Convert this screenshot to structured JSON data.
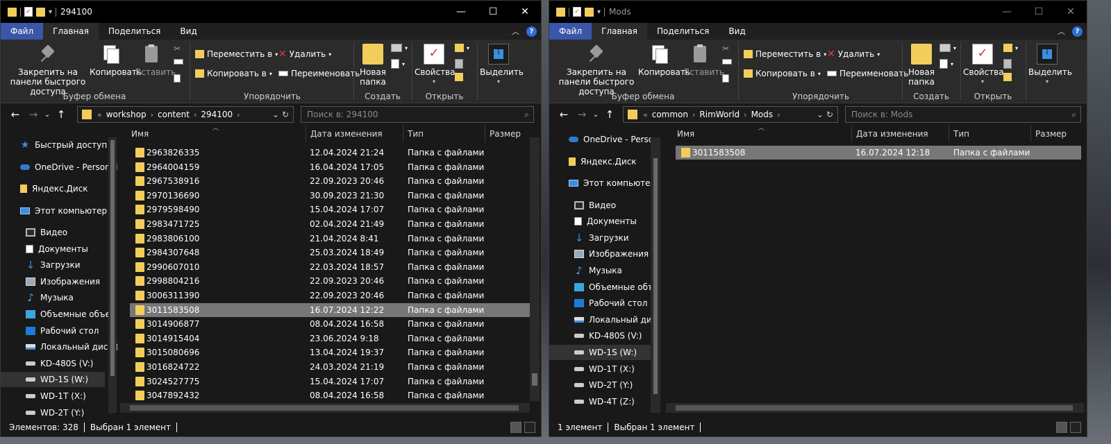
{
  "common": {
    "tabs": [
      "Файл",
      "Главная",
      "Поделиться",
      "Вид"
    ],
    "ribbon": {
      "pin_label": "Закрепить на панели быстрого доступа",
      "copy_label": "Копировать",
      "paste_label": "Вставить",
      "clipboard_group": "Буфер обмена",
      "move_to": "Переместить в",
      "copy_to": "Копировать в",
      "delete": "Удалить",
      "rename": "Переименовать",
      "organize_group": "Упорядочить",
      "new_folder": "Новая папка",
      "create_group": "Создать",
      "properties": "Свойства",
      "open_group": "Открыть",
      "select": "Выделить"
    },
    "column_headers": [
      "Имя",
      "Дата изменения",
      "Тип",
      "Размер"
    ],
    "caption": {
      "minimize": "—",
      "maximize": "☐",
      "close": "✕"
    },
    "help": "?"
  },
  "left_window": {
    "title": "294100",
    "path": [
      "workshop",
      "content",
      "294100"
    ],
    "search_placeholder": "Поиск в: 294100",
    "nav_items": [
      {
        "label": "Быстрый доступ",
        "icon": "star-icon"
      },
      {
        "label": "OneDrive - Personal",
        "icon": "cloud-icon"
      },
      {
        "label": "Яндекс.Диск",
        "icon": "yandex-disk-icon"
      },
      {
        "label": "Этот компьютер",
        "icon": "computer-icon"
      },
      {
        "label": "Видео",
        "icon": "video-icon"
      },
      {
        "label": "Документы",
        "icon": "documents-icon"
      },
      {
        "label": "Загрузки",
        "icon": "downloads-icon"
      },
      {
        "label": "Изображения",
        "icon": "images-icon"
      },
      {
        "label": "Музыка",
        "icon": "music-icon"
      },
      {
        "label": "Объемные объек",
        "icon": "3d-objects-icon"
      },
      {
        "label": "Рабочий стол",
        "icon": "desktop-icon"
      },
      {
        "label": "Локальный диск (",
        "icon": "local-disk-icon"
      },
      {
        "label": "KD-480S (V:)",
        "icon": "drive-icon"
      },
      {
        "label": "WD-1S (W:)",
        "icon": "drive-icon",
        "selected": true
      },
      {
        "label": "WD-1T (X:)",
        "icon": "drive-icon"
      },
      {
        "label": "WD-2T (Y:)",
        "icon": "drive-icon"
      }
    ],
    "files": [
      {
        "name": "2963826335",
        "date": "12.04.2024 21:24",
        "type": "Папка с файлами"
      },
      {
        "name": "2964004159",
        "date": "16.04.2024 17:05",
        "type": "Папка с файлами"
      },
      {
        "name": "2967538916",
        "date": "22.09.2023 20:46",
        "type": "Папка с файлами"
      },
      {
        "name": "2970136690",
        "date": "30.09.2023 21:30",
        "type": "Папка с файлами"
      },
      {
        "name": "2979598490",
        "date": "15.04.2024 17:07",
        "type": "Папка с файлами"
      },
      {
        "name": "2983471725",
        "date": "02.04.2024 21:49",
        "type": "Папка с файлами"
      },
      {
        "name": "2983806100",
        "date": "21.04.2024 8:41",
        "type": "Папка с файлами"
      },
      {
        "name": "2984307648",
        "date": "25.03.2024 18:49",
        "type": "Папка с файлами"
      },
      {
        "name": "2990607010",
        "date": "22.03.2024 18:57",
        "type": "Папка с файлами"
      },
      {
        "name": "2998804216",
        "date": "22.09.2023 20:46",
        "type": "Папка с файлами"
      },
      {
        "name": "3006311390",
        "date": "22.09.2023 20:46",
        "type": "Папка с файлами"
      },
      {
        "name": "3011583508",
        "date": "16.07.2024 12:22",
        "type": "Папка с файлами",
        "selected": true
      },
      {
        "name": "3014906877",
        "date": "08.04.2024 16:58",
        "type": "Папка с файлами"
      },
      {
        "name": "3014915404",
        "date": "23.06.2024 9:18",
        "type": "Папка с файлами"
      },
      {
        "name": "3015080696",
        "date": "13.04.2024 19:37",
        "type": "Папка с файлами"
      },
      {
        "name": "3016824722",
        "date": "24.03.2024 21:19",
        "type": "Папка с файлами"
      },
      {
        "name": "3024527775",
        "date": "15.04.2024 17:07",
        "type": "Папка с файлами"
      },
      {
        "name": "3047892432",
        "date": "08.04.2024 16:58",
        "type": "Папка с файлами"
      }
    ],
    "status_count": "Элементов: 328",
    "status_selected": "Выбран 1 элемент"
  },
  "right_window": {
    "title": "Mods",
    "path": [
      "common",
      "RimWorld",
      "Mods"
    ],
    "search_placeholder": "Поиск в: Mods",
    "nav_items": [
      {
        "label": "OneDrive - Personal",
        "icon": "cloud-icon"
      },
      {
        "label": "Яндекс.Диск",
        "icon": "yandex-disk-icon"
      },
      {
        "label": "Этот компьютер",
        "icon": "computer-icon"
      },
      {
        "label": "Видео",
        "icon": "video-icon"
      },
      {
        "label": "Документы",
        "icon": "documents-icon"
      },
      {
        "label": "Загрузки",
        "icon": "downloads-icon"
      },
      {
        "label": "Изображения",
        "icon": "images-icon"
      },
      {
        "label": "Музыка",
        "icon": "music-icon"
      },
      {
        "label": "Объемные объект",
        "icon": "3d-objects-icon"
      },
      {
        "label": "Рабочий стол",
        "icon": "desktop-icon"
      },
      {
        "label": "Локальный диск (",
        "icon": "local-disk-icon"
      },
      {
        "label": "KD-480S (V:)",
        "icon": "drive-icon"
      },
      {
        "label": "WD-1S (W:)",
        "icon": "drive-icon",
        "selected": true
      },
      {
        "label": "WD-1T (X:)",
        "icon": "drive-icon"
      },
      {
        "label": "WD-2T (Y:)",
        "icon": "drive-icon"
      },
      {
        "label": "WD-4T (Z:)",
        "icon": "drive-icon"
      }
    ],
    "files": [
      {
        "name": "3011583508",
        "date": "16.07.2024 12:18",
        "type": "Папка с файлами",
        "selected": true
      }
    ],
    "status_count": "1 элемент",
    "status_selected": "Выбран 1 элемент"
  }
}
